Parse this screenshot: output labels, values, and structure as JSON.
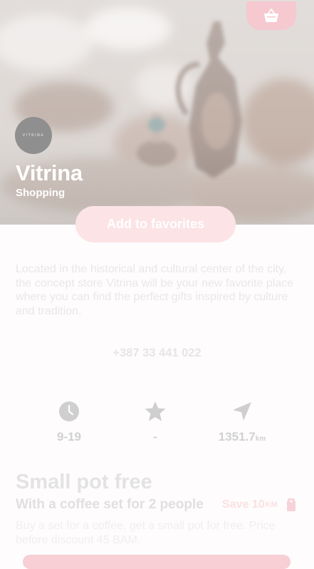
{
  "place": {
    "name": "Vitrina",
    "category": "Shopping",
    "logo_text": "VITRINA"
  },
  "actions": {
    "favorite_label": "Add to favorites"
  },
  "description": "Located in the historical and cultural center of the city, the concept store Vitrina will be your new favorite place where you can find the perfect gifts inspired by culture and tradition.",
  "contact": {
    "phone": "+387 33 441 022"
  },
  "stats": {
    "hours": "9-19",
    "rating": "-",
    "distance": "1351.7",
    "distance_unit": "km"
  },
  "offer": {
    "title": "Small pot free",
    "subtitle": "With a coffee set for 2 people",
    "save_text": "Save 10",
    "save_unit": "KM",
    "description": "Buy a set for a coffee, get a small pot for free. Price before discount 45 BAM."
  },
  "icons": {
    "basket": "basket-icon",
    "clock": "clock-icon",
    "star": "star-icon",
    "navigation": "navigation-arrow-icon",
    "tag": "price-tag-icon"
  },
  "colors": {
    "accent": "#f5c9cf",
    "accent_light": "#fbe3e6",
    "stat_icon": "#cfcfcf"
  }
}
